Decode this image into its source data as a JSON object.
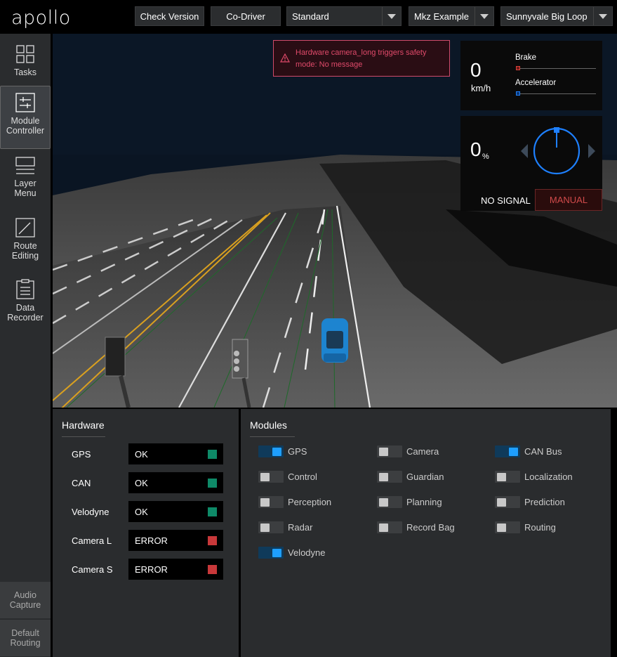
{
  "header": {
    "logo": "apollo",
    "check_version": "Check Version",
    "co_driver": "Co-Driver",
    "mode_select": "Standard",
    "vehicle_select": "Mkz Example",
    "map_select": "Sunnyvale Big Loop"
  },
  "sidebar": {
    "items": [
      {
        "label1": "Tasks",
        "label2": "",
        "icon": "grid-icon"
      },
      {
        "label1": "Module",
        "label2": "Controller",
        "icon": "sliders-icon"
      },
      {
        "label1": "Layer",
        "label2": "Menu",
        "icon": "layers-icon"
      },
      {
        "label1": "Route",
        "label2": "Editing",
        "icon": "route-icon"
      },
      {
        "label1": "Data",
        "label2": "Recorder",
        "icon": "clipboard-icon"
      }
    ],
    "bottom": [
      {
        "label1": "Audio",
        "label2": "Capture"
      },
      {
        "label1": "Default",
        "label2": "Routing"
      }
    ]
  },
  "scene": {
    "alert_line1": "Hardware camera_long triggers safety",
    "alert_line2": "mode: No message",
    "speed": "0",
    "speed_unit": "km/h",
    "brake_label": "Brake",
    "accelerator_label": "Accelerator",
    "brake_level": 0,
    "accelerator_level": 0,
    "steering": "0",
    "steering_unit": "%",
    "signal": "NO SIGNAL",
    "drive_mode": "MANUAL",
    "colors": {
      "brake": "#d9403a",
      "accelerator": "#1e80ff",
      "manual": "#d04a4a"
    }
  },
  "hardware": {
    "title": "Hardware",
    "rows": [
      {
        "name": "GPS",
        "status": "OK",
        "color": "#0e8a68"
      },
      {
        "name": "CAN",
        "status": "OK",
        "color": "#0e8a68"
      },
      {
        "name": "Velodyne",
        "status": "OK",
        "color": "#0e8a68"
      },
      {
        "name": "Camera L",
        "status": "ERROR",
        "color": "#c8383a"
      },
      {
        "name": "Camera S",
        "status": "ERROR",
        "color": "#c8383a"
      }
    ]
  },
  "modules": {
    "title": "Modules",
    "items": [
      {
        "name": "GPS",
        "on": true
      },
      {
        "name": "Camera",
        "on": false
      },
      {
        "name": "CAN Bus",
        "on": true
      },
      {
        "name": "Control",
        "on": false
      },
      {
        "name": "Guardian",
        "on": false
      },
      {
        "name": "Localization",
        "on": false
      },
      {
        "name": "Perception",
        "on": false
      },
      {
        "name": "Planning",
        "on": false
      },
      {
        "name": "Prediction",
        "on": false
      },
      {
        "name": "Radar",
        "on": false
      },
      {
        "name": "Record Bag",
        "on": false
      },
      {
        "name": "Routing",
        "on": false
      },
      {
        "name": "Velodyne",
        "on": true
      }
    ]
  }
}
